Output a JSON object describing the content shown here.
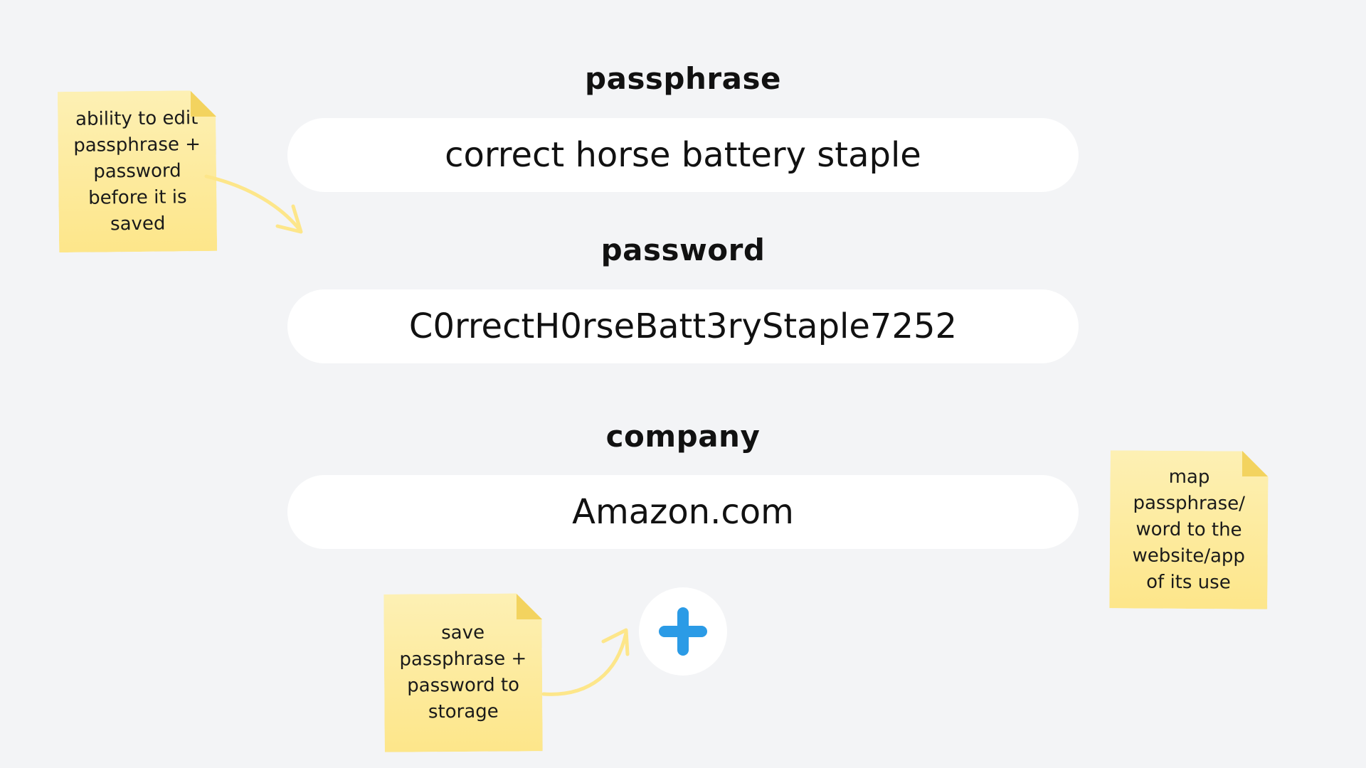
{
  "fields": {
    "passphrase": {
      "label": "passphrase",
      "value": "correct horse battery staple"
    },
    "password": {
      "label": "password",
      "value": "C0rrectH0rseBatt3ryStaple7252"
    },
    "company": {
      "label": "company",
      "value": "Amazon.com"
    }
  },
  "notes": {
    "edit": "ability to edit\npassphrase +\npassword\nbefore it is\nsaved",
    "map": "map\npassphrase/\nword to the\nwebsite/app\nof its use",
    "save": "save\npassphrase +\npassword to\nstorage"
  },
  "add_button": {
    "icon": "plus-icon",
    "color": "#2b9be6"
  },
  "colors": {
    "background": "#f3f4f6",
    "sticky": "#fde68a",
    "arrow": "#fde68a",
    "accent": "#2b9be6"
  }
}
